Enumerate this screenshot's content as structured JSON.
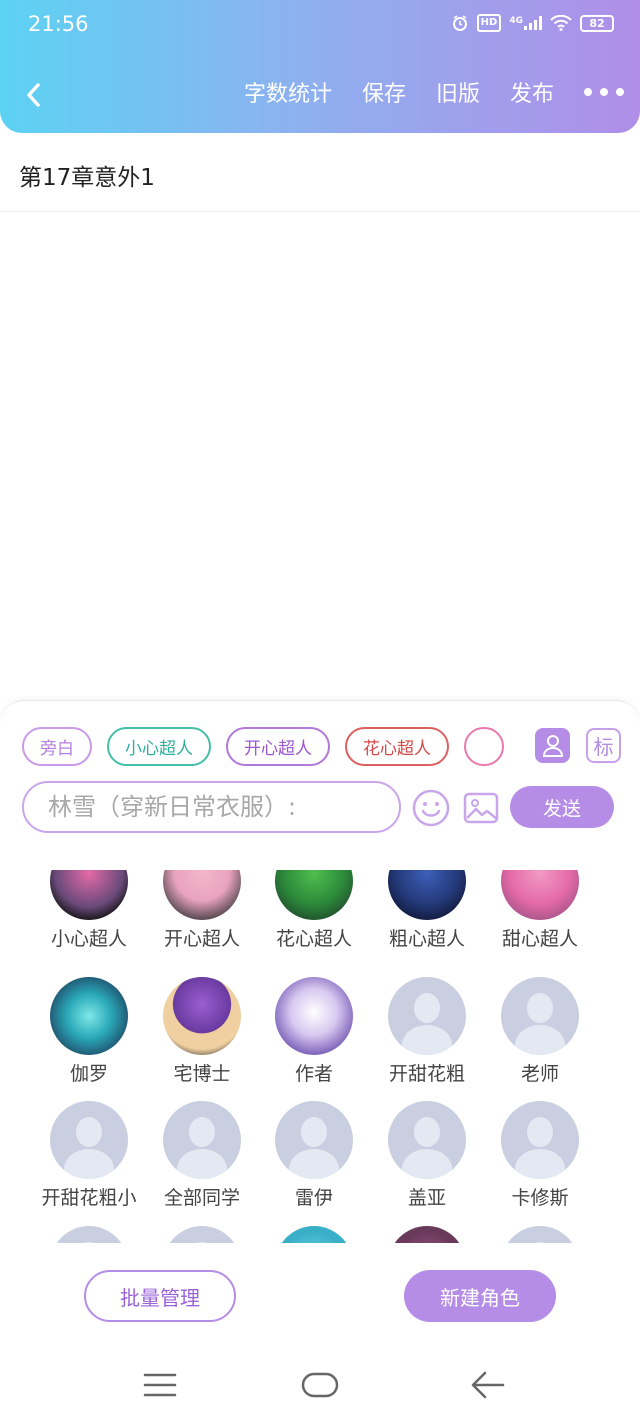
{
  "status_bar": {
    "time": "21:56",
    "hd_label": "HD",
    "network": "4G",
    "battery": "82"
  },
  "header": {
    "actions": [
      "字数统计",
      "保存",
      "旧版",
      "发布"
    ],
    "back_icon": "chevron-left-icon",
    "more_icon": "more-dots-icon",
    "gradient": [
      "#5cd2f3",
      "#b08ee8"
    ]
  },
  "chapter": {
    "title": "第17章意外1"
  },
  "composer": {
    "chips": [
      "旁白",
      "小心超人",
      "开心超人",
      "花心超人",
      ""
    ],
    "tag_label": "标",
    "input_placeholder": "林雪（穿新日常衣服）:",
    "send_label": "发送",
    "accent_color": "#b58ce6"
  },
  "characters": [
    {
      "name": "小心超人",
      "avatar": "photo"
    },
    {
      "name": "开心超人",
      "avatar": "photo"
    },
    {
      "name": "花心超人",
      "avatar": "photo"
    },
    {
      "name": "粗心超人",
      "avatar": "photo"
    },
    {
      "name": "甜心超人",
      "avatar": "photo"
    },
    {
      "name": "伽罗",
      "avatar": "photo"
    },
    {
      "name": "宅博士",
      "avatar": "photo"
    },
    {
      "name": "作者",
      "avatar": "photo"
    },
    {
      "name": "开甜花粗",
      "avatar": "default"
    },
    {
      "name": "老师",
      "avatar": "default"
    },
    {
      "name": "开甜花粗小",
      "avatar": "default"
    },
    {
      "name": "全部同学",
      "avatar": "default"
    },
    {
      "name": "雷伊",
      "avatar": "default"
    },
    {
      "name": "盖亚",
      "avatar": "default"
    },
    {
      "name": "卡修斯",
      "avatar": "default"
    }
  ],
  "footer": {
    "batch_label": "批量管理",
    "new_label": "新建角色"
  },
  "nav_bar": {
    "icons": [
      "menu-icon",
      "home-icon",
      "back-arrow-icon"
    ]
  }
}
